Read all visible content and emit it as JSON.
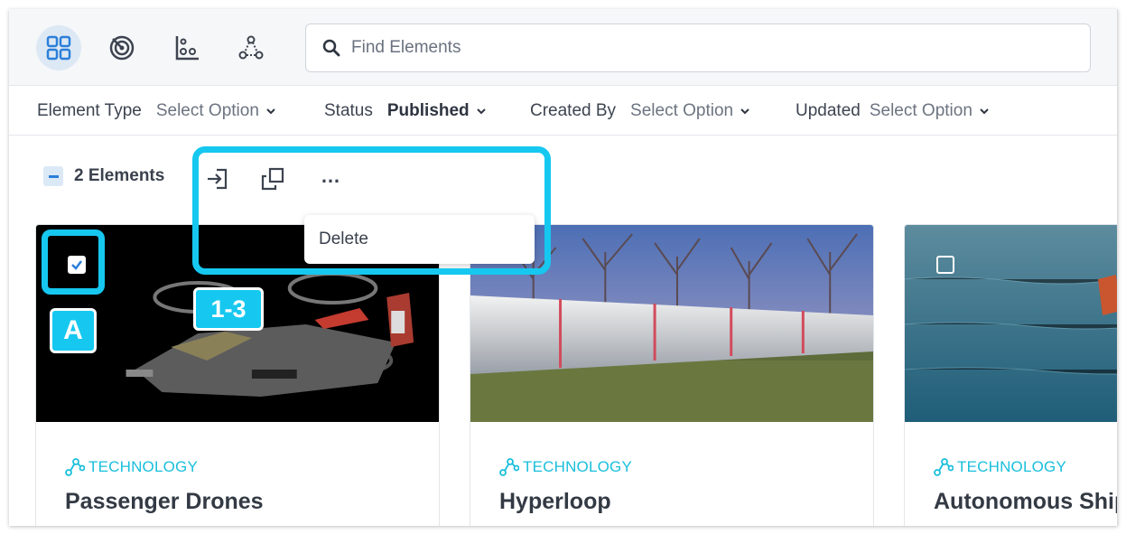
{
  "toolbar": {
    "view_modes": [
      {
        "icon": "grid-view-icon",
        "active": true
      },
      {
        "icon": "radar-view-icon",
        "active": false
      },
      {
        "icon": "chart-view-icon",
        "active": false
      },
      {
        "icon": "network-view-icon",
        "active": false
      }
    ],
    "search": {
      "placeholder": "Find Elements",
      "icon": "search-icon"
    }
  },
  "filters": [
    {
      "label": "Element Type",
      "value": "Select Option"
    },
    {
      "label": "Status",
      "value": "Published"
    },
    {
      "label": "Created By",
      "value": "Select Option"
    },
    {
      "label": "Updated",
      "value": "Select Option"
    }
  ],
  "selection": {
    "count_label": "2 Elements",
    "actions": [
      "import-icon",
      "duplicate-icon",
      "more-icon"
    ],
    "more_label": "…",
    "dropdown_item": "Delete"
  },
  "annotations": {
    "badge_a": "A",
    "badge_steps": "1-3",
    "accent": "#16c8f0"
  },
  "cards": [
    {
      "category": "TECHNOLOGY",
      "title": "Passenger Drones",
      "checked": true
    },
    {
      "category": "TECHNOLOGY",
      "title": "Hyperloop",
      "checked": true
    },
    {
      "category": "TECHNOLOGY",
      "title": "Autonomous Ship",
      "checked": false
    }
  ]
}
